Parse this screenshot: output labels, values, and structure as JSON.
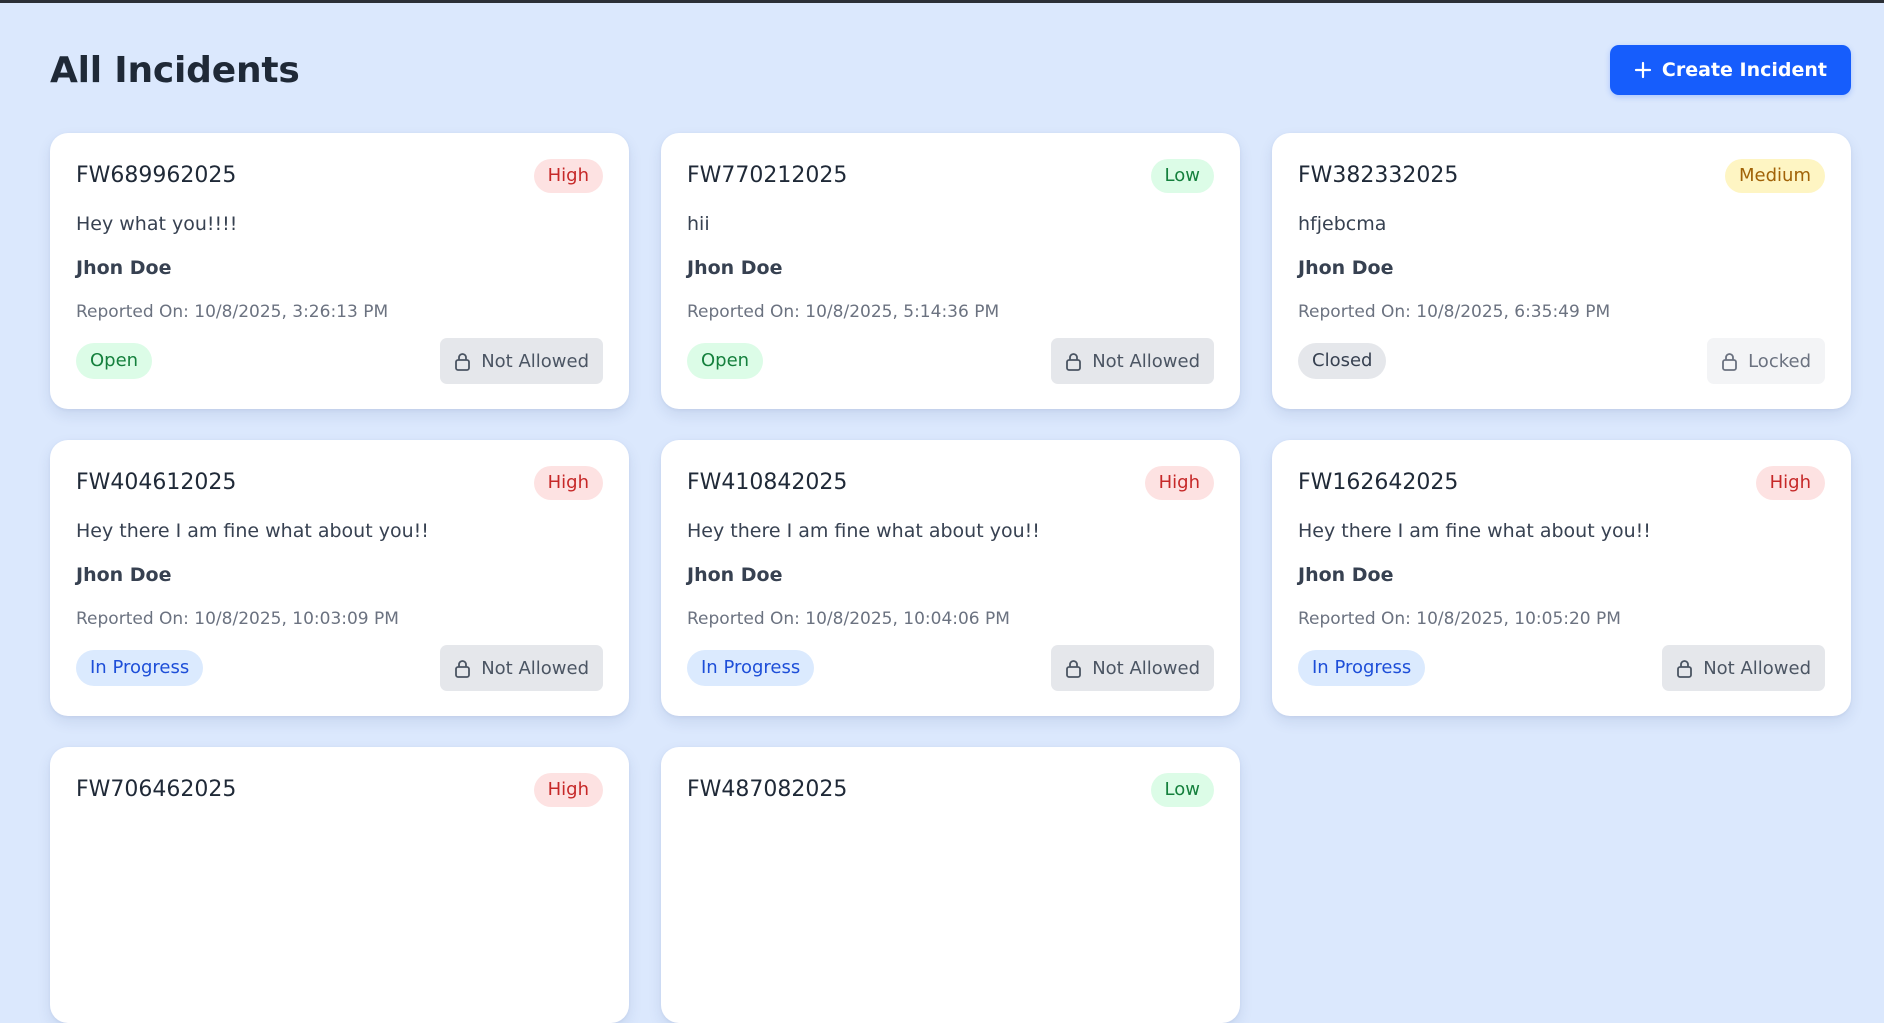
{
  "page": {
    "title": "All Incidents",
    "create_label": "Create Incident"
  },
  "incidents": [
    {
      "id": "FW689962025",
      "severity": "High",
      "description": "Hey what you!!!!",
      "reporter": "Jhon Doe",
      "reported_on": "Reported On: 10/8/2025, 3:26:13 PM",
      "status": "Open",
      "action": "Not Allowed"
    },
    {
      "id": "FW770212025",
      "severity": "Low",
      "description": "hii",
      "reporter": "Jhon Doe",
      "reported_on": "Reported On: 10/8/2025, 5:14:36 PM",
      "status": "Open",
      "action": "Not Allowed"
    },
    {
      "id": "FW382332025",
      "severity": "Medium",
      "description": "hfjebcma",
      "reporter": "Jhon Doe",
      "reported_on": "Reported On: 10/8/2025, 6:35:49 PM",
      "status": "Closed",
      "action": "Locked"
    },
    {
      "id": "FW404612025",
      "severity": "High",
      "description": "Hey there I am fine what about you!!",
      "reporter": "Jhon Doe",
      "reported_on": "Reported On: 10/8/2025, 10:03:09 PM",
      "status": "In Progress",
      "action": "Not Allowed"
    },
    {
      "id": "FW410842025",
      "severity": "High",
      "description": "Hey there I am fine what about you!!",
      "reporter": "Jhon Doe",
      "reported_on": "Reported On: 10/8/2025, 10:04:06 PM",
      "status": "In Progress",
      "action": "Not Allowed"
    },
    {
      "id": "FW162642025",
      "severity": "High",
      "description": "Hey there I am fine what about you!!",
      "reporter": "Jhon Doe",
      "reported_on": "Reported On: 10/8/2025, 10:05:20 PM",
      "status": "In Progress",
      "action": "Not Allowed"
    },
    {
      "id": "FW706462025",
      "severity": "High",
      "description": "",
      "reporter": "",
      "reported_on": "",
      "status": "",
      "action": ""
    },
    {
      "id": "FW487082025",
      "severity": "Low",
      "description": "",
      "reporter": "",
      "reported_on": "",
      "status": "",
      "action": ""
    }
  ],
  "colors": {
    "background": "#dbe8fd",
    "accent": "#165dfc",
    "high": "#c62828",
    "low": "#15803d",
    "medium": "#a16207",
    "in_progress": "#1d4ed8"
  },
  "icons": {
    "create": "plus-icon",
    "action": "lock-icon"
  }
}
